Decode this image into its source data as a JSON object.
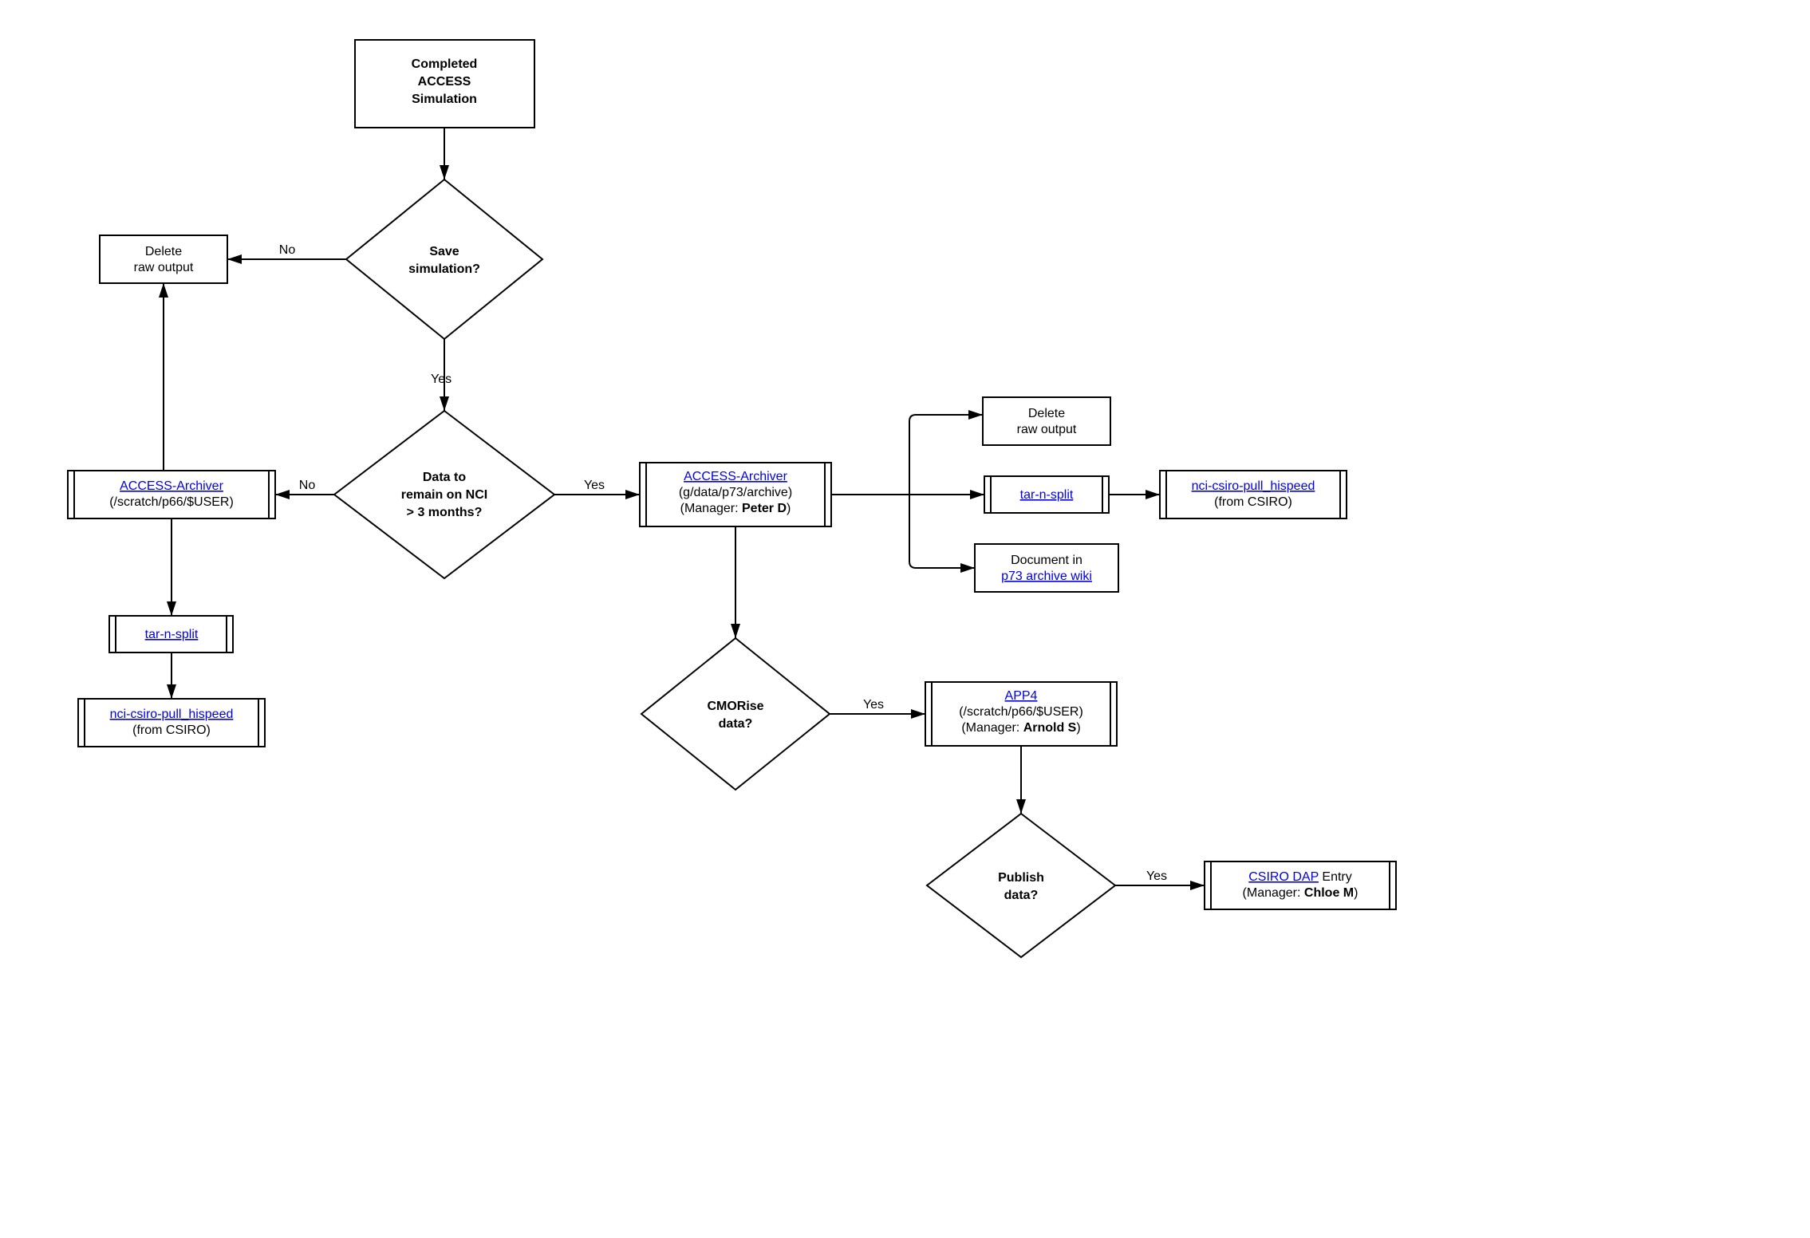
{
  "start": {
    "l1": "Completed",
    "l2": "ACCESS",
    "l3": "Simulation"
  },
  "deleteRaw1": {
    "l1": "Delete",
    "l2": "raw output"
  },
  "deleteRaw2": {
    "l1": "Delete",
    "l2": "raw output"
  },
  "saveSim": {
    "l1": "Save",
    "l2": "simulation?"
  },
  "remainNCI": {
    "l1": "Data to",
    "l2": "remain on NCI",
    "l3": "> 3 months?"
  },
  "cmorise": {
    "l1": "CMORise",
    "l2": "data?"
  },
  "publish": {
    "l1": "Publish",
    "l2": "data?"
  },
  "archiver1": {
    "link": "ACCESS-Archiver",
    "sub": "(/scratch/p66/$USER)"
  },
  "tarSplit1": {
    "link": "tar-n-split"
  },
  "pull1": {
    "link": "nci-csiro-pull_hispeed",
    "sub": "(from CSIRO)"
  },
  "archiver2": {
    "link": "ACCESS-Archiver",
    "sub1": "(g/data/p73/archive)",
    "sub2pre": "(Manager: ",
    "sub2b": "Peter D",
    "sub2post": ")"
  },
  "tarSplit2": {
    "link": "tar-n-split"
  },
  "pull2": {
    "link": "nci-csiro-pull_hispeed",
    "sub": "(from CSIRO)"
  },
  "docP73": {
    "pre": "Document in",
    "link": "p73 archive wiki"
  },
  "app4": {
    "link": "APP4",
    "sub1": "(/scratch/p66/$USER)",
    "sub2pre": "(Manager: ",
    "sub2b": "Arnold S",
    "sub2post": ")"
  },
  "dap": {
    "link": "CSIRO DAP",
    "suffix": " Entry",
    "sub2pre": "(Manager: ",
    "sub2b": "Chloe M",
    "sub2post": ")"
  },
  "labels": {
    "yes": "Yes",
    "no": "No"
  }
}
